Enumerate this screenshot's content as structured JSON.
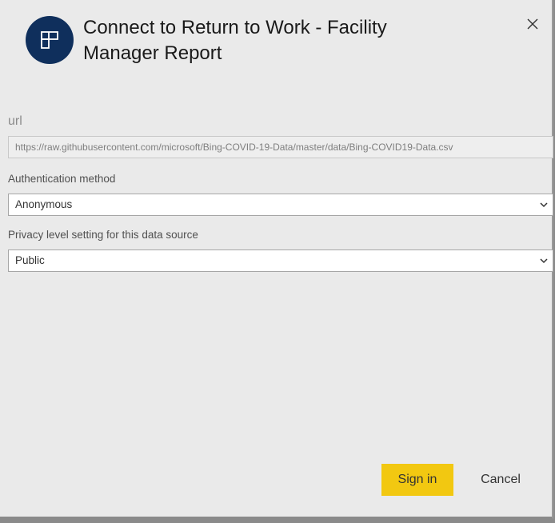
{
  "dialog": {
    "title": "Connect to Return to Work - Facility Manager Report",
    "header_icon": "report-app-icon",
    "close_icon": "close-icon"
  },
  "url": {
    "label": "url",
    "value": "https://raw.githubusercontent.com/microsoft/Bing-COVID-19-Data/master/data/Bing-COVID19-Data.csv"
  },
  "authentication": {
    "label": "Authentication method",
    "selected": "Anonymous"
  },
  "privacy": {
    "label": "Privacy level setting for this data source",
    "selected": "Public"
  },
  "actions": {
    "signin_label": "Sign in",
    "cancel_label": "Cancel"
  },
  "colors": {
    "accent": "#f2c811",
    "icon_bg": "#0f2f5c",
    "dialog_bg": "#eaeaea"
  }
}
